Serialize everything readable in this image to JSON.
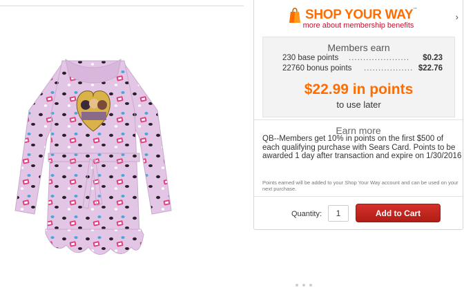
{
  "brand": {
    "logo_text_1": "SHOP",
    "logo_text_2": "YOUR",
    "logo_text_3": "WAY",
    "tm": "™",
    "benefits_link": "more about membership benefits",
    "accent_color": "#ff6c00",
    "link_color": "#c8102e"
  },
  "members_earn": {
    "title": "Members earn",
    "rows": [
      {
        "label": "230 base points",
        "dots": "...............................",
        "value": "$0.23"
      },
      {
        "label": "22760 bonus points",
        "dots": ".......................",
        "value": "$22.76"
      }
    ],
    "total": "$22.99 in points",
    "subtitle": "to use later"
  },
  "earn_more": {
    "title": "Earn more",
    "description": "QB--Members get 10% in points on the first $500 of each qualifying purchase with Sears Card. Points to be awarded 1 day after transaction and expire on 1/30/2016",
    "note": "Points earned will be added to your Shop Your Way account and can be used on your next purchase."
  },
  "purchase": {
    "quantity_label": "Quantity:",
    "quantity_value": "1",
    "add_to_cart": "Add to Cart",
    "button_color": "#c4241d"
  },
  "icons": {
    "bag": "shopping-bag-icon",
    "chevron": "chevron-right-icon"
  }
}
